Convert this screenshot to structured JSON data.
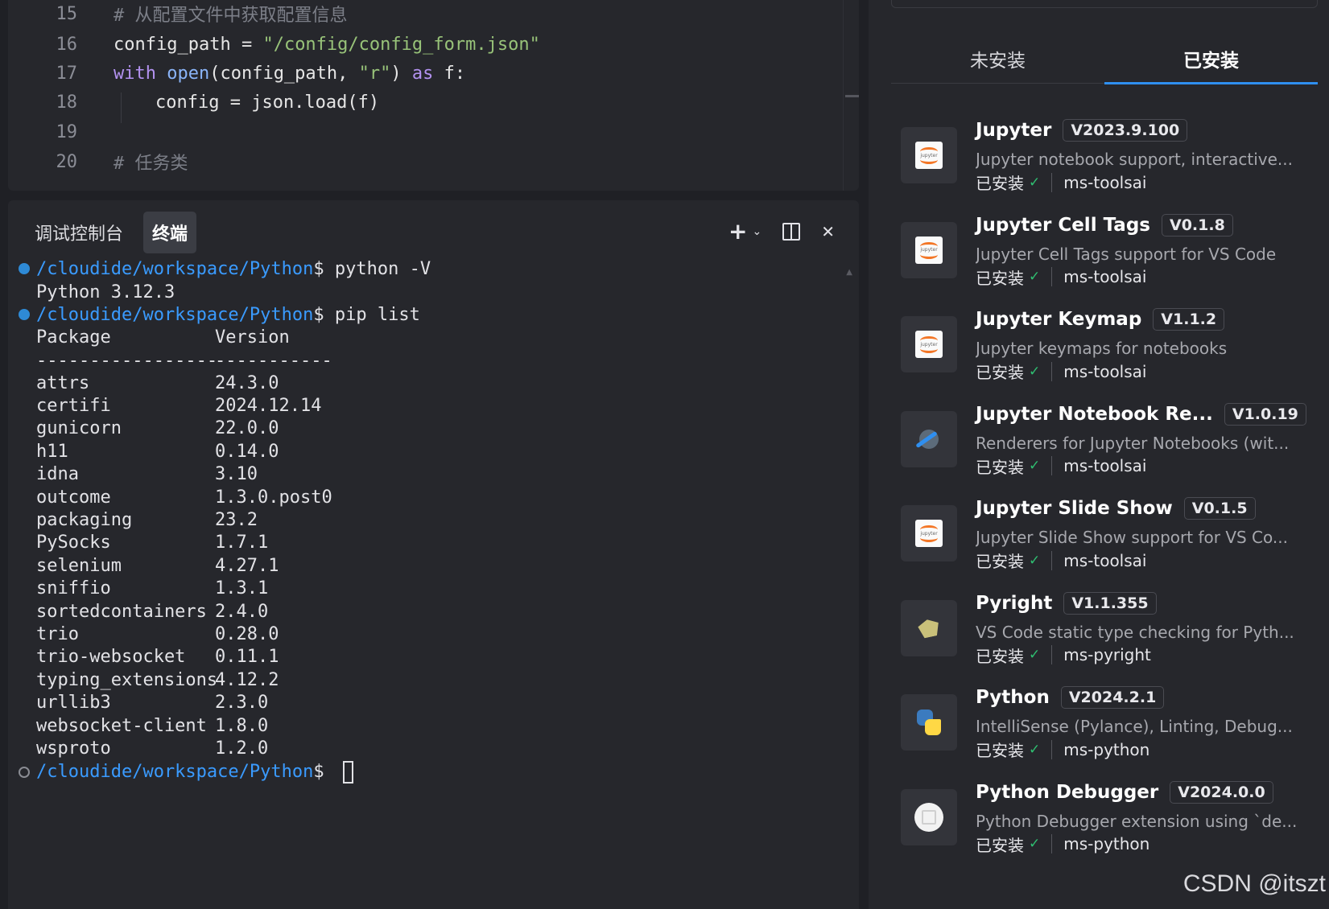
{
  "editor": {
    "lines": [
      {
        "num": "15",
        "text": "# 从配置文件中获取配置信息"
      },
      {
        "num": "16",
        "var": "config_path",
        "op": " = ",
        "str": "\"/config/config_form.json\""
      },
      {
        "num": "17",
        "kw1": "with",
        "fn": "open",
        "args_a": "(config_path, ",
        "str": "\"r\"",
        "args_b": ") ",
        "kw2": "as",
        "rest": " f:"
      },
      {
        "num": "18",
        "text": "config = json.load(f)"
      },
      {
        "num": "19",
        "text": ""
      },
      {
        "num": "20",
        "text": "# 任务类"
      }
    ]
  },
  "terminal": {
    "tabs": [
      {
        "label": "调试控制台",
        "active": false
      },
      {
        "label": "终端",
        "active": true
      }
    ],
    "tools": {
      "add": "+",
      "chevron": "⌄",
      "close": "✕"
    },
    "prompt_path": "/cloudide/workspace/Python",
    "prompt_sign": "$ ",
    "cmd1": "python -V",
    "out1": "Python 3.12.3",
    "cmd2": "pip list",
    "header": {
      "package": "Package",
      "version": "Version"
    },
    "divider": {
      "package": "-----------------",
      "version": "-----------"
    },
    "packages": [
      {
        "name": "attrs",
        "version": "24.3.0"
      },
      {
        "name": "certifi",
        "version": "2024.12.14"
      },
      {
        "name": "gunicorn",
        "version": "22.0.0"
      },
      {
        "name": "h11",
        "version": "0.14.0"
      },
      {
        "name": "idna",
        "version": "3.10"
      },
      {
        "name": "outcome",
        "version": "1.3.0.post0"
      },
      {
        "name": "packaging",
        "version": "23.2"
      },
      {
        "name": "PySocks",
        "version": "1.7.1"
      },
      {
        "name": "selenium",
        "version": "4.27.1"
      },
      {
        "name": "sniffio",
        "version": "1.3.1"
      },
      {
        "name": "sortedcontainers",
        "version": "2.4.0"
      },
      {
        "name": "trio",
        "version": "0.28.0"
      },
      {
        "name": "trio-websocket",
        "version": "0.11.1"
      },
      {
        "name": "typing_extensions",
        "version": "4.12.2"
      },
      {
        "name": "urllib3",
        "version": "2.3.0"
      },
      {
        "name": "websocket-client",
        "version": "1.8.0"
      },
      {
        "name": "wsproto",
        "version": "1.2.0"
      }
    ]
  },
  "extensions": {
    "tabs": [
      {
        "label": "未安装",
        "active": false
      },
      {
        "label": "已安装",
        "active": true
      }
    ],
    "items": [
      {
        "name": "Jupyter",
        "version": "V2023.9.100",
        "desc": "Jupyter notebook support, interactive...",
        "status": "已安装",
        "publisher": "ms-toolsai",
        "icon": "jupyter-icon"
      },
      {
        "name": "Jupyter Cell Tags",
        "version": "V0.1.8",
        "desc": "Jupyter Cell Tags support for VS Code",
        "status": "已安装",
        "publisher": "ms-toolsai",
        "icon": "jupyter-icon"
      },
      {
        "name": "Jupyter Keymap",
        "version": "V1.1.2",
        "desc": "Jupyter keymaps for notebooks",
        "status": "已安装",
        "publisher": "ms-toolsai",
        "icon": "jupyter-icon"
      },
      {
        "name": "Jupyter Notebook Re...",
        "version": "V1.0.19",
        "desc": "Renderers for Jupyter Notebooks (wit...",
        "status": "已安装",
        "publisher": "ms-toolsai",
        "icon": "renderer-icon"
      },
      {
        "name": "Jupyter Slide Show",
        "version": "V0.1.5",
        "desc": "Jupyter Slide Show support for VS Co...",
        "status": "已安装",
        "publisher": "ms-toolsai",
        "icon": "jupyter-icon"
      },
      {
        "name": "Pyright",
        "version": "V1.1.355",
        "desc": "VS Code static type checking for Pyth...",
        "status": "已安装",
        "publisher": "ms-pyright",
        "icon": "pyright-icon"
      },
      {
        "name": "Python",
        "version": "V2024.2.1",
        "desc": "IntelliSense (Pylance), Linting, Debug...",
        "status": "已安装",
        "publisher": "ms-python",
        "icon": "python-icon"
      },
      {
        "name": "Python Debugger",
        "version": "V2024.0.0",
        "desc": "Python Debugger extension using `de...",
        "status": "已安装",
        "publisher": "ms-python",
        "icon": "debugger-icon"
      }
    ],
    "check_glyph": "✓"
  },
  "watermark": "CSDN @itszt",
  "colors": {
    "accent": "#2f8ff0",
    "prompt": "#3a9bff",
    "check": "#2fbf71",
    "string": "#98c379",
    "keyword": "#b392f0"
  }
}
